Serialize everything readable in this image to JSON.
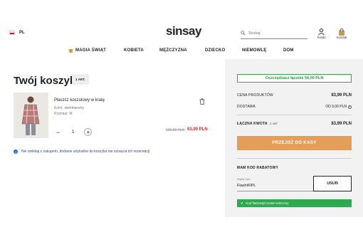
{
  "header": {
    "language": "PL",
    "logo": "sinsay",
    "search_placeholder": "Szukaj",
    "account_label": "Konto",
    "cart_label": "Koszyk"
  },
  "nav": {
    "items": [
      {
        "label": "MAGIA ŚWIĄT",
        "icon": "gift-icon"
      },
      {
        "label": "KOBIETA"
      },
      {
        "label": "MĘŻCZYZNA"
      },
      {
        "label": "DZIECKO"
      },
      {
        "label": "NIEMOWLĘ"
      },
      {
        "label": "DOM"
      }
    ]
  },
  "cart": {
    "title": "Twój koszyk",
    "count_badge": "1 ART.",
    "item": {
      "name": "Płaszcz koszulowy w kratę",
      "color": "Kolor: wielobarwny",
      "size": "Rozmiar: M",
      "quantity": "1",
      "price_old": "139,99 PLN",
      "price_new": "83,99 PLN"
    },
    "info_note": "Nie zwlekaj z zakupem, dodanie artykułów do koszyka nie oznacza ich rezerwacji"
  },
  "summary": {
    "savings_text": "Oszczędzasz łącznie 56,00 PLN",
    "products_label": "CENA PRODUKTÓW",
    "products_value": "83,99 PLN",
    "delivery_label": "DOSTAWA",
    "delivery_value": "OD 0,00 PLN",
    "total_label": "ŁĄCZNA KWOTA",
    "total_vat": "Z VAT",
    "total_value": "83,99 PLN",
    "checkout_label": "PRZEJDŹ DO KASY",
    "discount_heading": "MAM KOD RABATOWY",
    "discount_field_label": "Wpisz kod",
    "discount_field_value": "Flash40PL",
    "remove_label": "USUŃ",
    "success_text": "Kod flash40pl został naliczony"
  },
  "colors": {
    "accent": "#e59e5a",
    "success": "#2fa84f",
    "sale": "#d32f2f",
    "info": "#2a6bd1"
  }
}
